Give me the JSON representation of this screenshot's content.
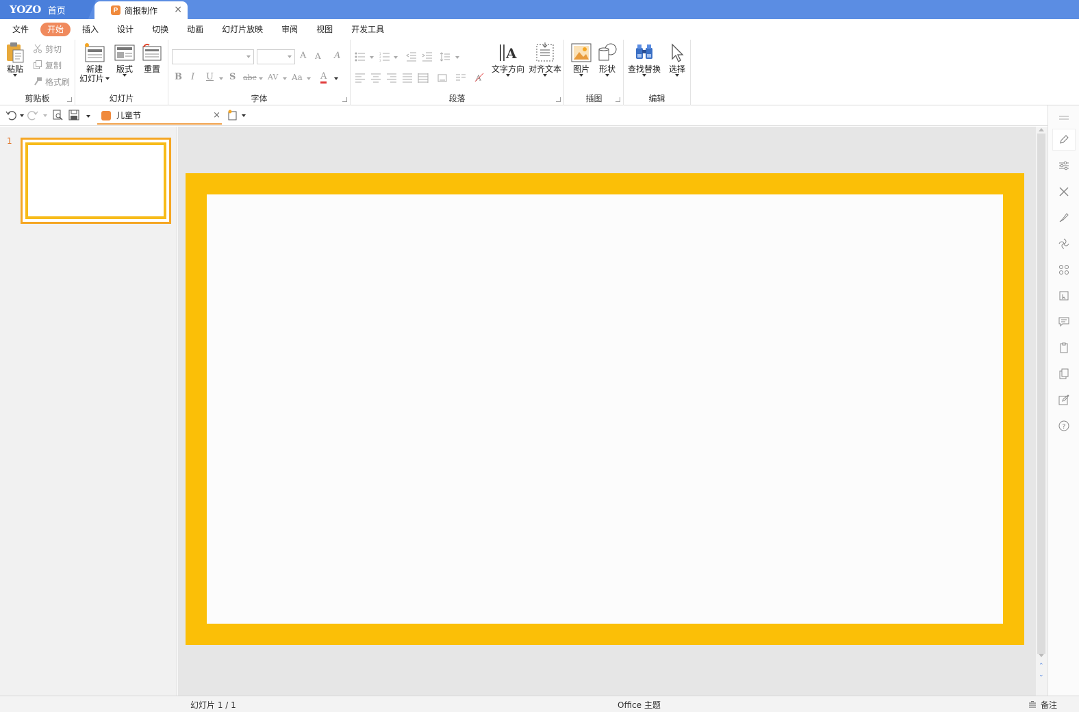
{
  "titlebar": {
    "logo": "YOZO",
    "home_label": "首页",
    "doc_tab_icon": "P",
    "doc_tab_label": "简报制作",
    "close_glyph": "×"
  },
  "menubar": {
    "items": [
      "文件",
      "开始",
      "插入",
      "设计",
      "切换",
      "动画",
      "幻灯片放映",
      "审阅",
      "视图",
      "开发工具"
    ],
    "active": "开始"
  },
  "ribbon": {
    "clipboard": {
      "label": "剪贴板",
      "paste": "粘贴",
      "cut": "剪切",
      "copy": "复制",
      "format_painter": "格式刷"
    },
    "slides": {
      "label": "幻灯片",
      "new_slide_line1": "新建",
      "new_slide_line2": "幻灯片",
      "layout": "版式",
      "reset": "重置"
    },
    "font": {
      "label": "字体",
      "bold": "B",
      "italic": "I",
      "underline": "U",
      "shadow": "S",
      "strike": "abc",
      "spacing": "AV",
      "case": "Aa",
      "font_color": "A",
      "grow": "A",
      "shrink": "A"
    },
    "paragraph": {
      "label": "段落"
    },
    "text_direction": "文字方向",
    "align_text": "对齐文本",
    "insert": {
      "label": "插图",
      "picture": "图片",
      "shape": "形状"
    },
    "edit": {
      "label": "编辑",
      "find_replace": "查找替换",
      "select": "选择"
    }
  },
  "quickbar": {
    "doc_name": "儿童节",
    "close_glyph": "×"
  },
  "slide_panel": {
    "slide_number": "1"
  },
  "statusbar": {
    "slide_info": "幻灯片 1 / 1",
    "theme": "Office 主题",
    "notes": "备注"
  },
  "colors": {
    "titlebar": "#5b8de3",
    "active_menu": "#f08a5d",
    "slide_border": "#fbbf07",
    "thumb_border": "#f5a623"
  }
}
